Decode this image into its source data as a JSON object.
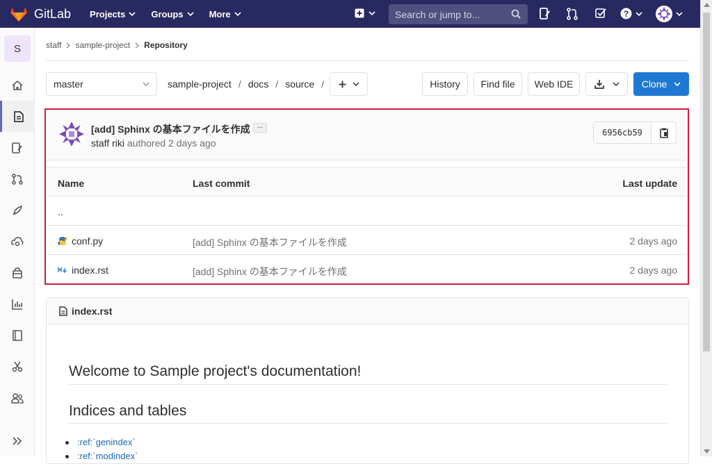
{
  "topbar": {
    "brand": "GitLab",
    "nav": [
      {
        "label": "Projects"
      },
      {
        "label": "Groups"
      },
      {
        "label": "More"
      }
    ],
    "search_placeholder": "Search or jump to..."
  },
  "sidebar": {
    "project_initial": "S",
    "items": [
      "project-overview",
      "repository",
      "issues",
      "merge-requests",
      "ci-cd",
      "operations",
      "packages",
      "analytics",
      "wiki",
      "snippets",
      "members",
      "collapse"
    ]
  },
  "breadcrumb": {
    "items": [
      "staff",
      "sample-project",
      "Repository"
    ]
  },
  "toolbar": {
    "branch": "master",
    "path": [
      "sample-project",
      "docs",
      "source"
    ],
    "path_sep": "/",
    "history": "History",
    "find_file": "Find file",
    "web_ide": "Web IDE",
    "clone": "Clone"
  },
  "commit": {
    "title": "[add] Sphinx の基本ファイルを作成",
    "author": "staff riki",
    "authored": "authored 2 days ago",
    "sha": "6956cb59"
  },
  "table": {
    "headers": {
      "name": "Name",
      "last_commit": "Last commit",
      "last_update": "Last update"
    },
    "parent": "..",
    "rows": [
      {
        "name": "conf.py",
        "icon": "python-file-icon",
        "commit": "[add] Sphinx の基本ファイルを作成",
        "updated": "2 days ago"
      },
      {
        "name": "index.rst",
        "icon": "markdown-file-icon",
        "commit": "[add] Sphinx の基本ファイルを作成",
        "updated": "2 days ago"
      }
    ]
  },
  "readme": {
    "filename": "index.rst",
    "h1": "Welcome to Sample project's documentation!",
    "h2": "Indices and tables",
    "items": [
      ":ref:`genindex`",
      ":ref:`modindex`"
    ]
  },
  "colors": {
    "topbar": "#292961",
    "clone": "#1f78d1",
    "highlight": "#d0193a"
  }
}
